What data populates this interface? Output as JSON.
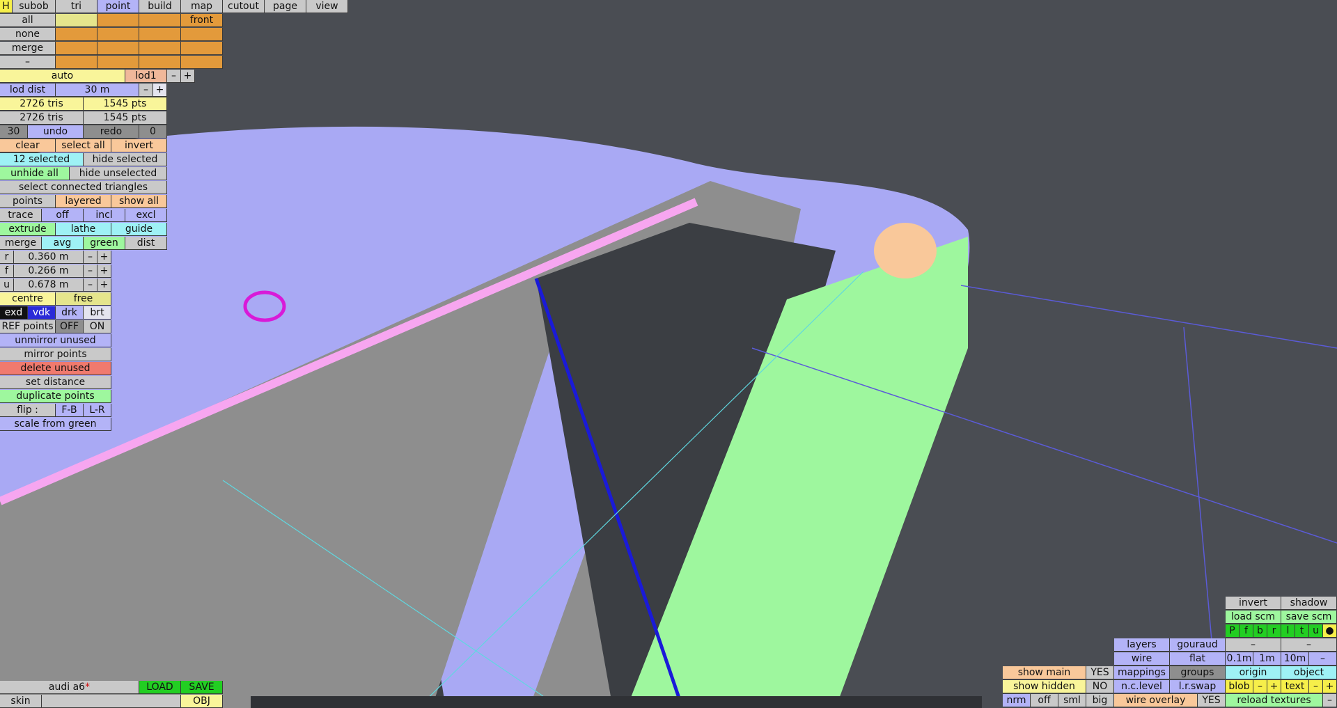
{
  "top_tabs": [
    "H",
    "subob",
    "tri",
    "point",
    "build",
    "map",
    "cutout",
    "page",
    "view"
  ],
  "row_all": "all",
  "row_none": "none",
  "row_merge": "merge",
  "row_dash": "–",
  "front": "front",
  "auto": "auto",
  "lod1": "lod1",
  "minus": "–",
  "plus": "+",
  "lod_dist_label": "lod dist",
  "lod_dist_value": "30 m",
  "tris1": "2726 tris",
  "pts1": "1545 pts",
  "tris2": "2726 tris",
  "pts2": "1545 pts",
  "n30": "30",
  "undo": "undo",
  "redo": "redo",
  "n0": "0",
  "clear": "clear",
  "select_all": "select all",
  "invert": "invert",
  "selected": "12 selected",
  "hide_selected": "hide selected",
  "unhide_all": "unhide all",
  "hide_unselected": "hide unselected",
  "select_connected": "select connected triangles",
  "points": "points",
  "layered": "layered",
  "show_all": "show all",
  "trace": "trace",
  "off": "off",
  "incl": "incl",
  "excl": "excl",
  "extrude": "extrude",
  "lathe": "lathe",
  "guide": "guide",
  "merge2": "merge",
  "avg": "avg",
  "green": "green",
  "dist": "dist",
  "r_label": "r",
  "r_value": "0.360 m",
  "f_label": "f",
  "f_value": "0.266 m",
  "u_label": "u",
  "u_value": "0.678 m",
  "centre": "centre",
  "free": "free",
  "exd": "exd",
  "vdk": "vdk",
  "drk": "drk",
  "brt": "brt",
  "ref_points": "REF points",
  "OFF": "OFF",
  "ON": "ON",
  "unmirror_unused": "unmirror unused",
  "mirror_points": "mirror points",
  "delete_unused": "delete unused",
  "set_distance": "set distance",
  "duplicate_points": "duplicate points",
  "flip": "flip :",
  "fb": "F-B",
  "lr": "L-R",
  "scale_from_green": "scale from green",
  "file_name": "audi a6",
  "file_mod": "*",
  "load": "LOAD",
  "save": "SAVE",
  "skin": "skin",
  "obj": "OBJ",
  "br": {
    "invert": "invert",
    "shadow": "shadow",
    "load_scm": "load scm",
    "save_scm": "save scm",
    "pf": [
      "P",
      "f",
      "b",
      "r",
      "l",
      "t",
      "u",
      "●"
    ],
    "layers": "layers",
    "gouraud": "gouraud",
    "dash": "–",
    "wire": "wire",
    "flat": "flat",
    "s01": "0.1m",
    "s1": "1m",
    "s10": "10m",
    "show_main": "show main",
    "yes": "YES",
    "mappings": "mappings",
    "groups": "groups",
    "origin": "origin",
    "object": "object",
    "show_hidden": "show hidden",
    "no": "NO",
    "nclevel": "n.c.level",
    "lrswap": "l.r.swap",
    "blob": "blob",
    "text": "text",
    "nrm": "nrm",
    "off": "off",
    "sml": "sml",
    "big": "big",
    "wire_overlay": "wire overlay",
    "reload": "reload textures"
  },
  "colors": {
    "background": "#4a4d53",
    "lavender": "#b3b3f7",
    "orange": "#e39a3b",
    "green": "#9ef79e",
    "yellow": "#f9f59a"
  }
}
